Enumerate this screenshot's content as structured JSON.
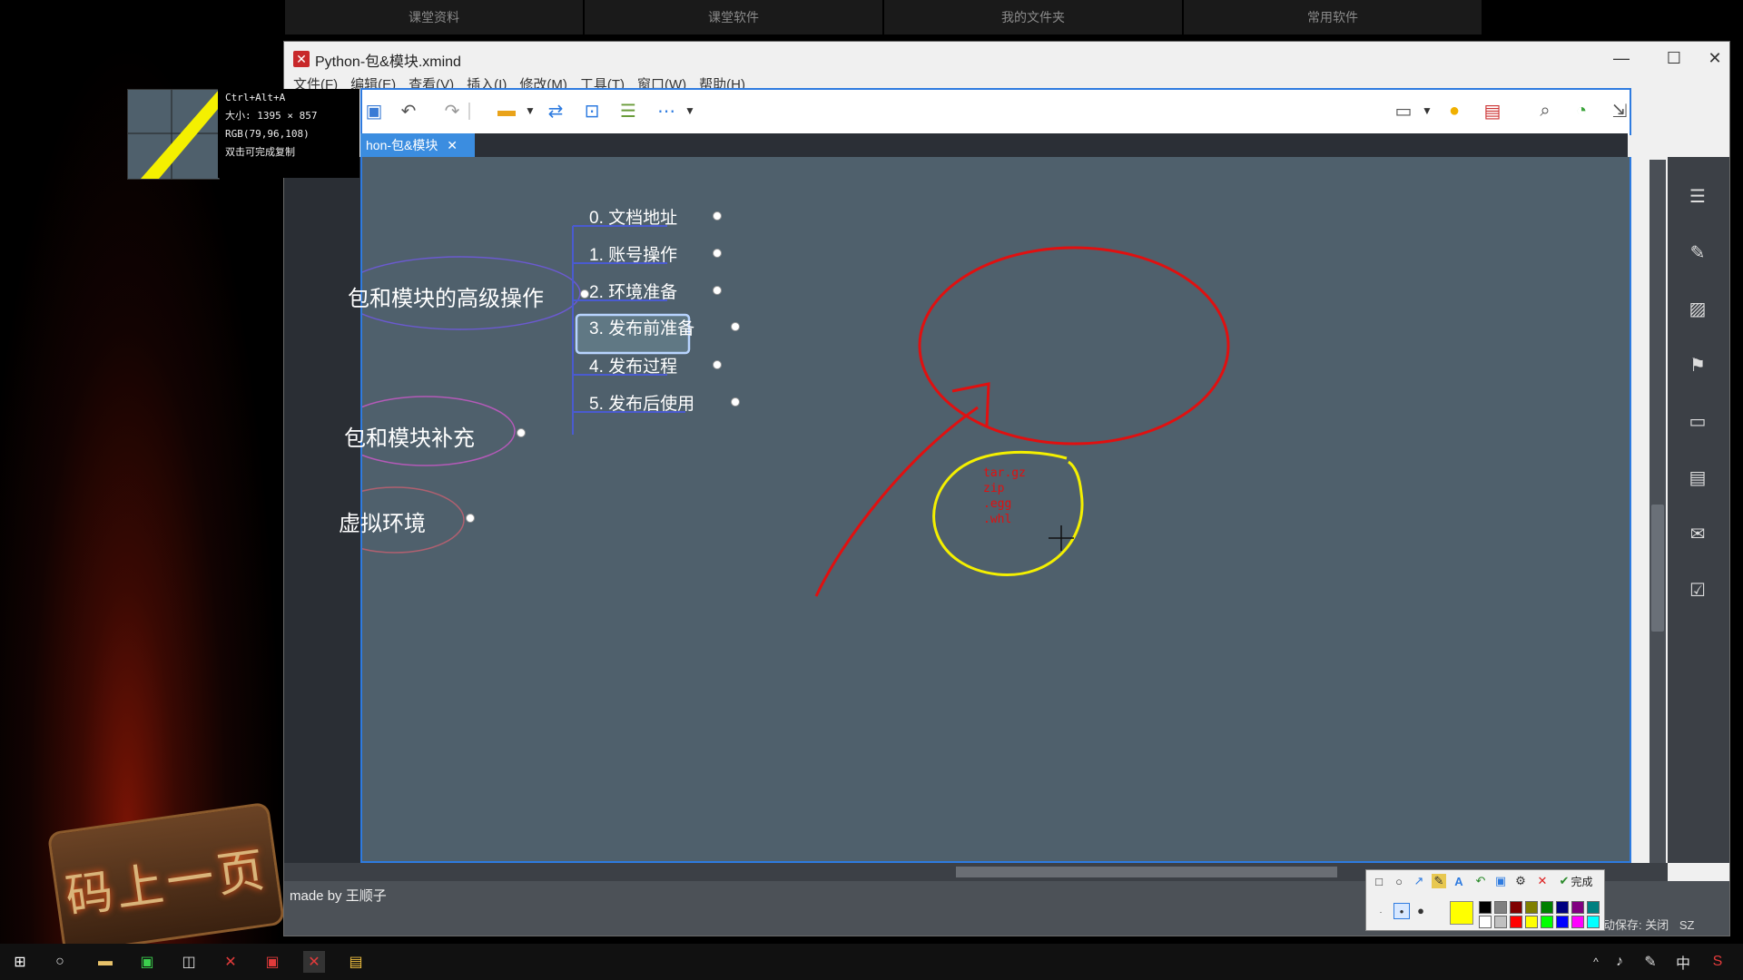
{
  "top_nav": [
    "课堂资料",
    "课堂软件",
    "我的文件夹",
    "常用软件"
  ],
  "window": {
    "title": "Python-包&模块.xmind",
    "minimize_icon": "minimize-icon",
    "maximize_icon": "maximize-icon",
    "close_icon": "close-icon"
  },
  "menu": [
    "文件(F)",
    "编辑(E)",
    "查看(V)",
    "插入(I)",
    "修改(M)",
    "工具(T)",
    "窗口(W)",
    "帮助(H)"
  ],
  "doc_tab": {
    "label": "hon-包&模块",
    "close": "✕"
  },
  "magnifier": {
    "hotkey": "Ctrl+Alt+A",
    "size_label": "大小: 1395 × 857",
    "rgb_label": "RGB(79,96,108)",
    "hint": "双击可完成复制"
  },
  "mindmap": {
    "main_topics": [
      "包和模块的高级操作",
      "包和模块补充",
      "虚拟环境"
    ],
    "subtopics": [
      "0. 文档地址",
      "1. 账号操作",
      "2. 环境准备",
      "3. 发布前准备",
      "4. 发布过程",
      "5. 发布后使用"
    ],
    "selected_subtopic": "3. 发布前准备",
    "annotation_text": [
      "tar.gz",
      "zip",
      ".egg",
      ".whl"
    ]
  },
  "status": {
    "made_by": "made by 王顺子",
    "autosave": "自动保存: 关闭",
    "sz": "SZ"
  },
  "palette": {
    "done_label": "完成",
    "selected_color": "#ffff00",
    "colors": [
      "#000000",
      "#808080",
      "#800000",
      "#808000",
      "#008000",
      "#000080",
      "#800080",
      "#008080",
      "#ffffff",
      "#c0c0c0",
      "#ff0000",
      "#ffff00",
      "#00ff00",
      "#0000ff",
      "#ff00ff",
      "#00ffff"
    ]
  },
  "colors": {
    "canvas_bg": "#4f606c",
    "selection_blue": "#2e7be0",
    "ink_red": "#e01010",
    "ink_yellow": "#f4f000"
  },
  "taskbar": {
    "time_lang": "中"
  },
  "logo_text": "码上一页"
}
